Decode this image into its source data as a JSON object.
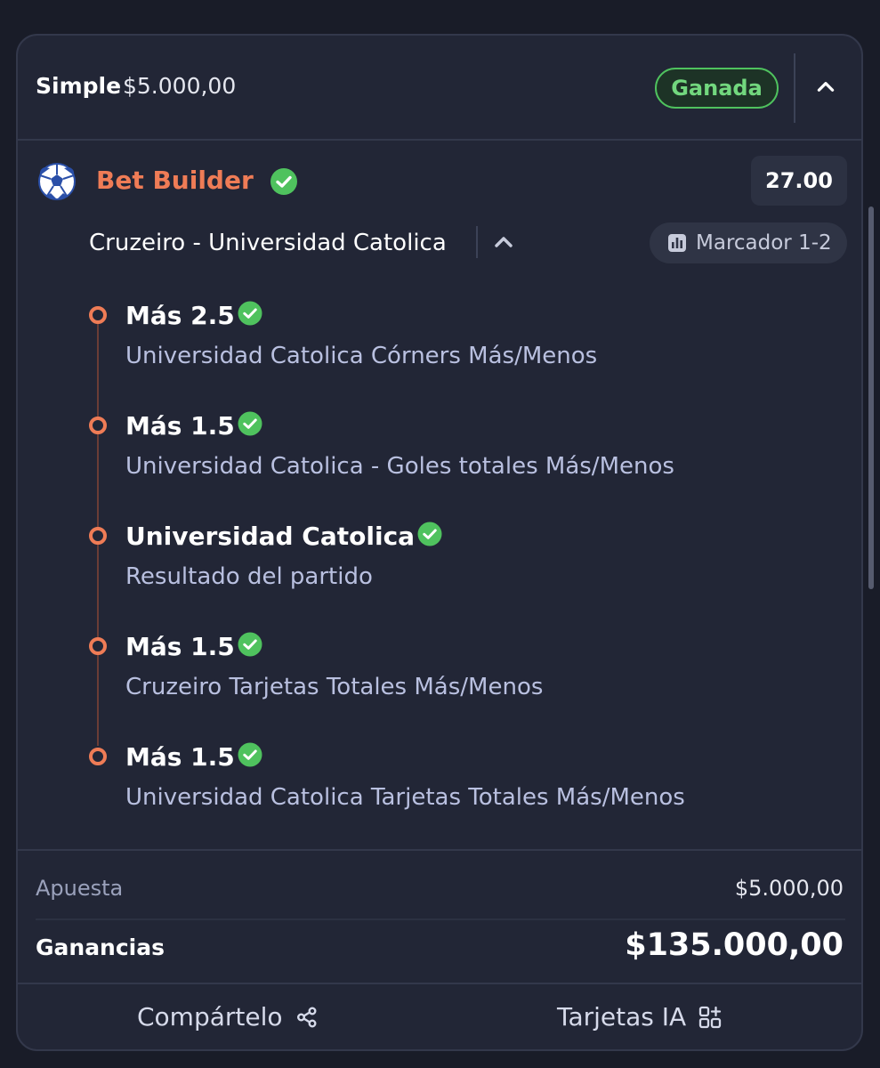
{
  "bet": {
    "type": "Simple",
    "amount": "$5.000,00",
    "status": "Ganada"
  },
  "builder": {
    "title": "Bet Builder",
    "odds": "27.00",
    "match": "Cruzeiro - Universidad Catolica",
    "score": "Marcador 1-2",
    "icon": "soccer-ball-icon"
  },
  "selections": [
    {
      "name": "Más 2.5",
      "market": "Universidad Catolica Córners Más/Menos",
      "status": "won"
    },
    {
      "name": "Más 1.5",
      "market": "Universidad Catolica - Goles totales Más/Menos",
      "status": "won"
    },
    {
      "name": "Universidad Catolica",
      "market": "Resultado del partido",
      "status": "won"
    },
    {
      "name": "Más 1.5",
      "market": "Cruzeiro Tarjetas Totales Más/Menos",
      "status": "won"
    },
    {
      "name": "Más 1.5",
      "market": "Universidad Catolica Tarjetas Totales Más/Menos",
      "status": "won"
    }
  ],
  "summary": {
    "stake_label": "Apuesta",
    "stake_value": "$5.000,00",
    "winnings_label": "Ganancias",
    "winnings_value": "$135.000,00"
  },
  "actions": {
    "share_label": "Compártelo",
    "ai_cards_label": "Tarjetas IA"
  },
  "colors": {
    "accent": "#ef7c56",
    "success": "#4fc25e",
    "background": "#222636"
  }
}
